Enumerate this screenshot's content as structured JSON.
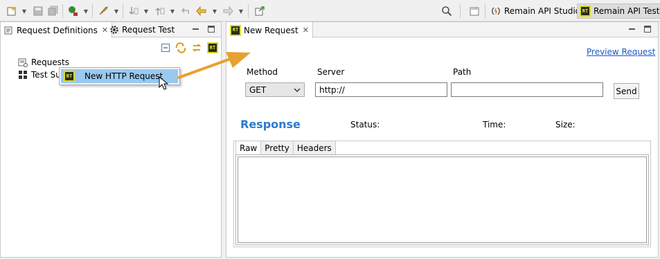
{
  "toolbar": {
    "perspectives": [
      {
        "label": "Remain API Studio"
      },
      {
        "label": "Remain API Test"
      }
    ],
    "badge_text": "RT"
  },
  "left_panel": {
    "tabs": [
      {
        "label": "Request Definitions"
      },
      {
        "label": "Request Test"
      }
    ],
    "tree": [
      {
        "label": "Requests"
      },
      {
        "label": "Test Sui"
      }
    ],
    "context_menu": {
      "item": "New HTTP Request"
    }
  },
  "editor": {
    "tab": {
      "label": "New Request"
    },
    "preview_link": "Preview Request",
    "method": {
      "label": "Method",
      "value": "GET"
    },
    "server": {
      "label": "Server",
      "value": "http://"
    },
    "path": {
      "label": "Path",
      "value": ""
    },
    "send_label": "Send",
    "response": {
      "title": "Response",
      "status_label": "Status:",
      "time_label": "Time:",
      "size_label": "Size:",
      "tabs": [
        {
          "label": "Raw"
        },
        {
          "label": "Pretty"
        },
        {
          "label": "Headers"
        }
      ]
    }
  },
  "colors": {
    "accent_link": "#1a56c8",
    "response_title": "#2b7ad0",
    "menu_highlight": "#99c9ef",
    "arrow": "#e8a030",
    "rt_badge_border": "#d8dc28"
  }
}
